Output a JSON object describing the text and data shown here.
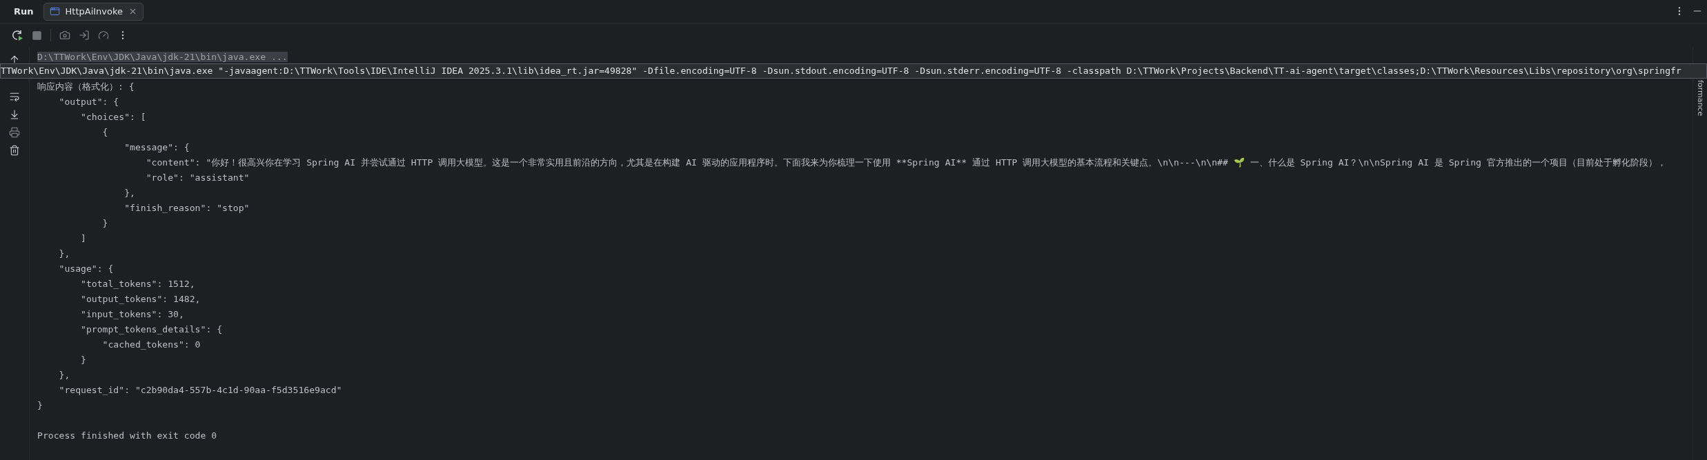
{
  "tool_window": {
    "title": "Run",
    "tabs": [
      {
        "label": "HttpAiInvoke",
        "selected": true
      }
    ]
  },
  "console": {
    "command_line": "D:\\TTWork\\Env\\JDK\\Java\\jdk-21\\bin\\java.exe ...",
    "tooltip": "TTWork\\Env\\JDK\\Java\\jdk-21\\bin\\java.exe \"-javaagent:D:\\TTWork\\Tools\\IDE\\IntelliJ IDEA 2025.3.1\\lib\\idea_rt.jar=49828\" -Dfile.encoding=UTF-8 -Dsun.stdout.encoding=UTF-8 -Dsun.stderr.encoding=UTF-8 -classpath D:\\TTWork\\Projects\\Backend\\TT-ai-agent\\target\\classes;D:\\TTWork\\Resources\\Libs\\repository\\org\\springfr",
    "lines": [
      "响应内容（格式化）: {",
      "    \"output\": {",
      "        \"choices\": [",
      "            {",
      "                \"message\": {",
      "                    \"content\": \"你好！很高兴你在学习 Spring AI 并尝试通过 HTTP 调用大模型。这是一个非常实用且前沿的方向，尤其是在构建 AI 驱动的应用程序时。下面我来为你梳理一下使用 **Spring AI** 通过 HTTP 调用大模型的基本流程和关键点。\\n\\n---\\n\\n## 🌱 一、什么是 Spring AI？\\n\\nSpring AI 是 Spring 官方推出的一个项目（目前处于孵化阶段），",
      "                    \"role\": \"assistant\"",
      "                },",
      "                \"finish_reason\": \"stop\"",
      "            }",
      "        ]",
      "    },",
      "    \"usage\": {",
      "        \"total_tokens\": 1512,",
      "        \"output_tokens\": 1482,",
      "        \"input_tokens\": 30,",
      "        \"prompt_tokens_details\": {",
      "            \"cached_tokens\": 0",
      "        }",
      "    },",
      "    \"request_id\": \"c2b90da4-557b-4c1d-90aa-f5d3516e9acd\"",
      "}"
    ],
    "exit_message": "Process finished with exit code 0"
  },
  "side_stripe": {
    "label": "formance"
  }
}
